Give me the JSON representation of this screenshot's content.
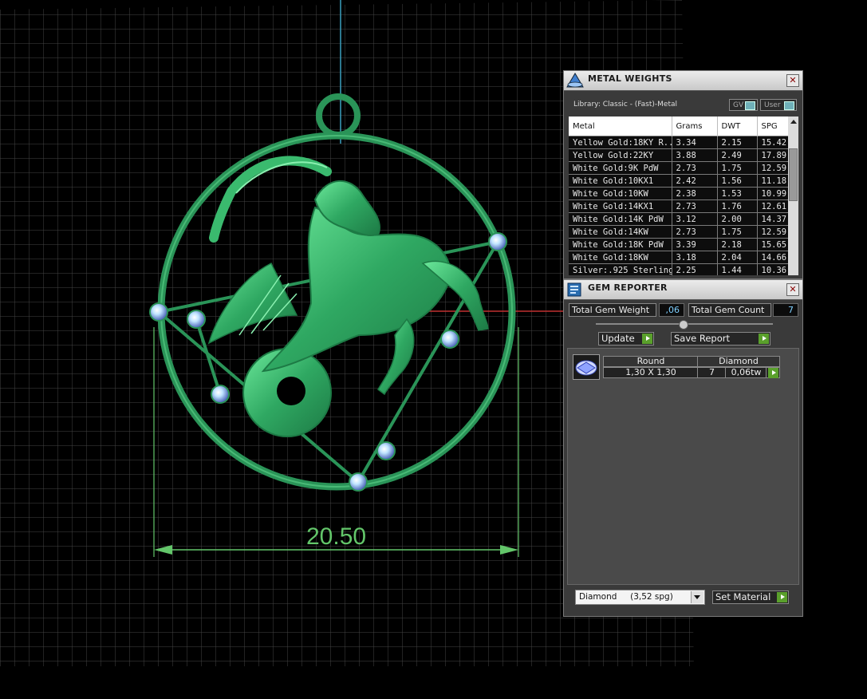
{
  "viewport": {
    "dimension_value": "20.50",
    "colors": {
      "grid": "#3e3e3e",
      "model": "#2fa862",
      "dimension": "#63c66a"
    }
  },
  "metal_weights": {
    "title": "METAL WEIGHTS",
    "close": "✕",
    "library": "Library: Classic - (Fast)-Metal",
    "gv_label": "GV",
    "user_label": "User",
    "columns": [
      "Metal",
      "Grams",
      "DWT",
      "SPG"
    ],
    "rows": [
      [
        "Yellow Gold:18KY R...",
        "3.34",
        "2.15",
        "15.42"
      ],
      [
        "Yellow Gold:22KY",
        "3.88",
        "2.49",
        "17.89"
      ],
      [
        "White Gold:9K PdW",
        "2.73",
        "1.75",
        "12.59"
      ],
      [
        "White Gold:10KX1",
        "2.42",
        "1.56",
        "11.18"
      ],
      [
        "White Gold:10KW",
        "2.38",
        "1.53",
        "10.99"
      ],
      [
        "White Gold:14KX1",
        "2.73",
        "1.76",
        "12.61"
      ],
      [
        "White Gold:14K PdW",
        "3.12",
        "2.00",
        "14.37"
      ],
      [
        "White Gold:14KW",
        "2.73",
        "1.75",
        "12.59"
      ],
      [
        "White Gold:18K PdW",
        "3.39",
        "2.18",
        "15.65"
      ],
      [
        "White Gold:18KW",
        "3.18",
        "2.04",
        "14.66"
      ],
      [
        "Silver:.925 Sterling",
        "2.25",
        "1.44",
        "10.36"
      ]
    ]
  },
  "gem_reporter": {
    "title": "GEM REPORTER",
    "close": "✕",
    "total_weight_label": "Total Gem Weight",
    "total_weight_value": ",06",
    "total_count_label": "Total Gem Count",
    "total_count_value": "7",
    "update_label": "Update",
    "save_label": "Save Report",
    "gem": {
      "shape": "Round",
      "material": "Diamond",
      "size": "1,30 X 1,30",
      "count": "7",
      "weight": "0,06tw"
    },
    "material_select": "Diamond     (3,52 spg)",
    "set_material_label": "Set Material"
  }
}
